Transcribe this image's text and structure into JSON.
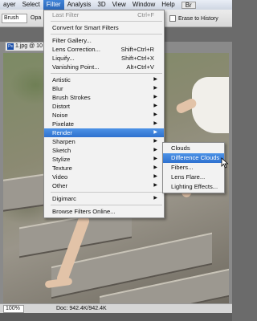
{
  "menubar": {
    "items": [
      "ayer",
      "Select",
      "Filter",
      "Analysis",
      "3D",
      "View",
      "Window",
      "Help"
    ],
    "active_index": 2,
    "extra": "Br"
  },
  "options_bar": {
    "brush_mode": "Brush",
    "opacity_label": "Opa",
    "erase_to_history": "Erase to History"
  },
  "document": {
    "tab_title": "1.jpg @ 10",
    "zoom": "100%",
    "doc_info": "Doc: 942.4K/942.4K"
  },
  "filter_menu": {
    "items": [
      {
        "label": "Last Filter",
        "shortcut": "Ctrl+F",
        "disabled": true
      },
      {
        "type": "sep"
      },
      {
        "label": "Convert for Smart Filters"
      },
      {
        "type": "sep"
      },
      {
        "label": "Filter Gallery..."
      },
      {
        "label": "Lens Correction...",
        "shortcut": "Shift+Ctrl+R"
      },
      {
        "label": "Liquify...",
        "shortcut": "Shift+Ctrl+X"
      },
      {
        "label": "Vanishing Point...",
        "shortcut": "Alt+Ctrl+V"
      },
      {
        "type": "sep"
      },
      {
        "label": "Artistic",
        "submenu": true
      },
      {
        "label": "Blur",
        "submenu": true
      },
      {
        "label": "Brush Strokes",
        "submenu": true
      },
      {
        "label": "Distort",
        "submenu": true
      },
      {
        "label": "Noise",
        "submenu": true
      },
      {
        "label": "Pixelate",
        "submenu": true
      },
      {
        "label": "Render",
        "submenu": true,
        "highlighted": true
      },
      {
        "label": "Sharpen",
        "submenu": true
      },
      {
        "label": "Sketch",
        "submenu": true
      },
      {
        "label": "Stylize",
        "submenu": true
      },
      {
        "label": "Texture",
        "submenu": true
      },
      {
        "label": "Video",
        "submenu": true
      },
      {
        "label": "Other",
        "submenu": true
      },
      {
        "type": "sep"
      },
      {
        "label": "Digimarc",
        "submenu": true
      },
      {
        "type": "sep"
      },
      {
        "label": "Browse Filters Online..."
      }
    ]
  },
  "render_submenu": {
    "items": [
      {
        "label": "Clouds"
      },
      {
        "label": "Difference Clouds",
        "highlighted": true
      },
      {
        "label": "Fibers..."
      },
      {
        "label": "Lens Flare..."
      },
      {
        "label": "Lighting Effects..."
      }
    ]
  },
  "colors": {
    "highlight": "#2e71cf",
    "menu_bg": "#f2f2f2"
  }
}
